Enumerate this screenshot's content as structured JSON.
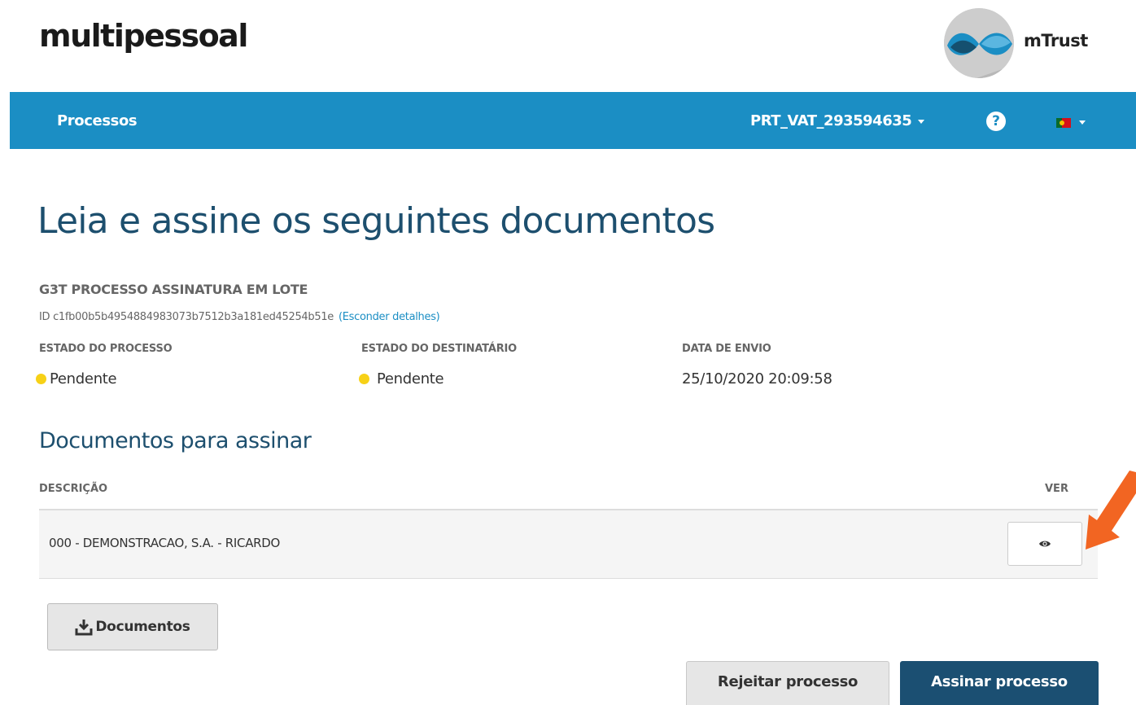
{
  "header": {
    "brand": "multipessoal",
    "partner_logo_text": "mTrust"
  },
  "navbar": {
    "processes_link": "Processos",
    "account": "PRT_VAT_293594635",
    "help_glyph": "?",
    "language_flag": "flag-pt-icon"
  },
  "page": {
    "title": "Leia e assine os seguintes documentos"
  },
  "process": {
    "name": "G3T PROCESSO ASSINATURA EM LOTE",
    "id_text": "ID c1fb00b5b4954884983073b7512b3a181ed45254b51e",
    "toggle_details_link": "(Esconder detalhes)",
    "columns": [
      {
        "label": "ESTADO DO PROCESSO",
        "value": "Pendente"
      },
      {
        "label": "ESTADO DO DESTINATÁRIO",
        "value": "Pendente"
      },
      {
        "label": "DATA DE ENVIO",
        "value": "25/10/2020 20:09:58"
      }
    ],
    "status_color": "#f7d117"
  },
  "documents": {
    "title": "Documentos para assinar",
    "headers": {
      "description": "DESCRIÇÃO",
      "view": "VER"
    },
    "rows": [
      {
        "description": "000 - DEMONSTRACAO, S.A. - RICARDO",
        "view_icon": "eye-icon"
      }
    ]
  },
  "actions": {
    "download_documents": "Documentos",
    "reject": "Rejeitar processo",
    "sign": "Assinar processo"
  },
  "colors": {
    "navbar": "#1b8ec4",
    "title": "#1d4f6e",
    "primary_button": "#1b4f72",
    "annotation_arrow": "#f26522"
  }
}
